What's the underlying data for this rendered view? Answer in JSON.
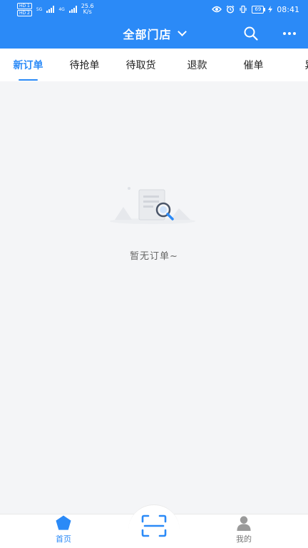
{
  "status_bar": {
    "sim1": "HD 1",
    "sim2": "HD 2",
    "net1": "5G",
    "net2": "4G",
    "speed_value": "25.6",
    "speed_unit": "K/s",
    "battery": "69",
    "time": "08:41"
  },
  "header": {
    "title": "全部门店",
    "icons": [
      "chevron-down-icon",
      "search-icon",
      "more-icon"
    ]
  },
  "tabs": [
    {
      "label": "新订单",
      "active": true
    },
    {
      "label": "待抢单",
      "active": false
    },
    {
      "label": "待取货",
      "active": false
    },
    {
      "label": "退款",
      "active": false
    },
    {
      "label": "催单",
      "active": false
    },
    {
      "label": "异",
      "active": false
    }
  ],
  "empty_state": {
    "message": "暂无订单~",
    "icon": "empty-orders-illustration"
  },
  "bottom_nav": {
    "home_label": "首页",
    "scan_icon": "scan-icon",
    "mine_label": "我的"
  },
  "colors": {
    "primary": "#2b8af7",
    "background": "#f4f5f7",
    "inactive": "#777777"
  }
}
